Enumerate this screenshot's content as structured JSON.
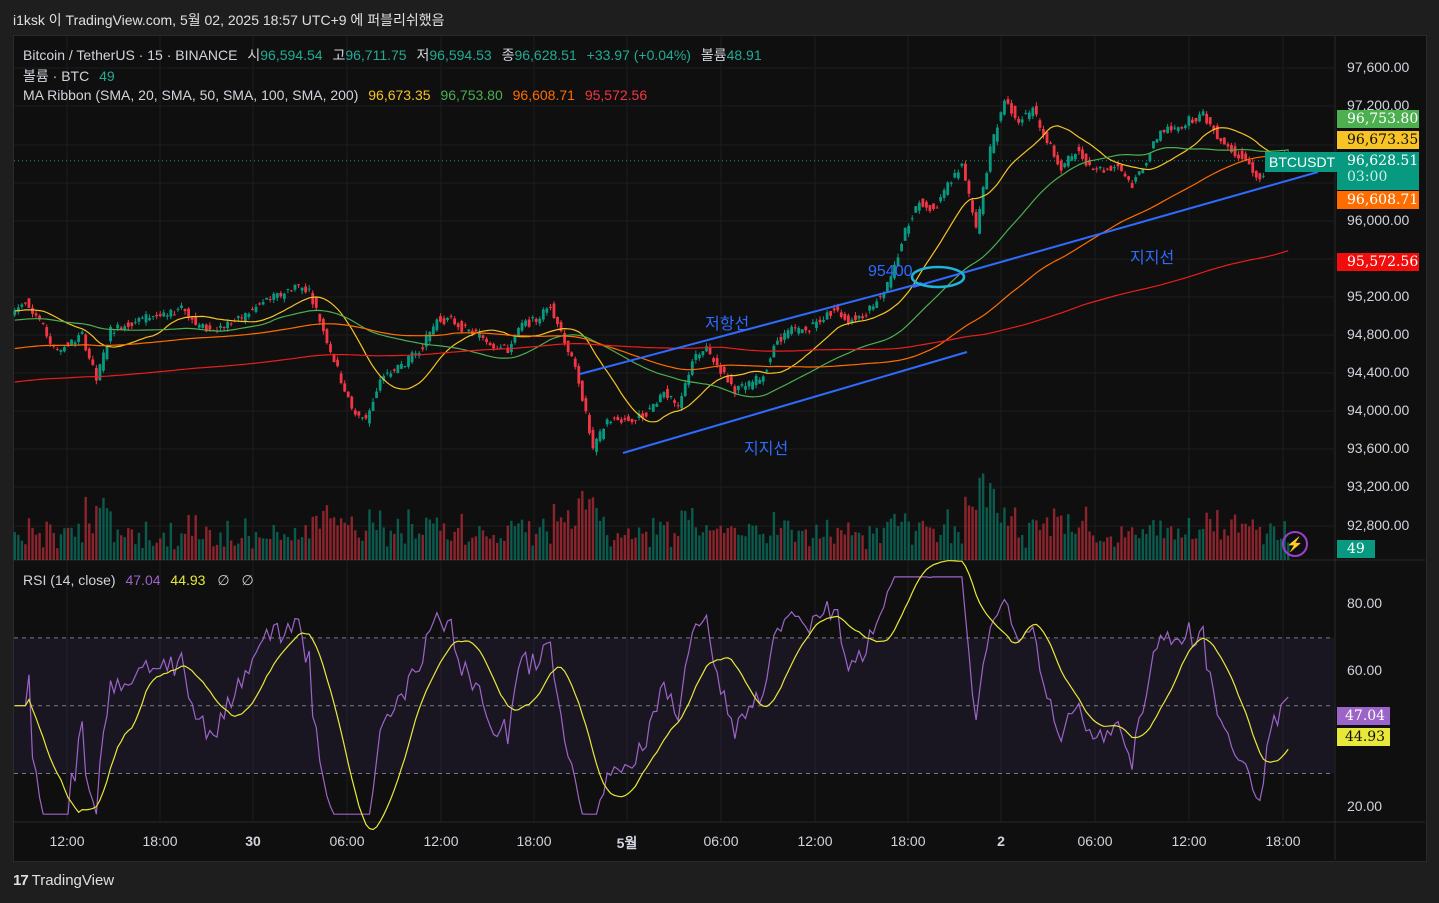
{
  "header": {
    "publish_line": "i1ksk 이 TradingView.com, 5월 02, 2025 18:57 UTC+9 에 퍼블리쉬했음"
  },
  "legend": {
    "symbol": "Bitcoin / TetherUS · 15 · BINANCE",
    "open_label": "시",
    "open": "96,594.54",
    "high_label": "고",
    "high": "96,711.75",
    "low_label": "저",
    "low": "96,594.53",
    "close_label": "종",
    "close": "96,628.51",
    "change": "+33.97 (+0.04%)",
    "vol_label": "볼륨",
    "vol": "48.91",
    "volume_title": "볼륨 · BTC",
    "volume_value": "49",
    "ma_title": "MA Ribbon (SMA, 20, SMA, 50, SMA, 100, SMA, 200)",
    "ma_values": [
      "96,673.35",
      "96,753.80",
      "96,608.71",
      "95,572.56"
    ],
    "rsi_title": "RSI (14, close)",
    "rsi_value": "47.04",
    "rsi_ma": "44.93",
    "rsi_icons": [
      "∅",
      "∅"
    ]
  },
  "price_tags": {
    "ma50": "96,753.80",
    "ma20": "96,673.35",
    "last": "96,628.51",
    "countdown": "03:00",
    "ma100": "96,608.71",
    "ma200": "95,572.56",
    "symbol": "BTCUSDT",
    "volume": "49",
    "rsi": "47.04",
    "rsi_ma": "44.93"
  },
  "annotations": {
    "level": "95400",
    "resistance": "저항선",
    "support1": "지지선",
    "support2": "지지선"
  },
  "footer": {
    "brand": "TradingView"
  },
  "colors": {
    "up": "#089981",
    "down": "#f23645",
    "ma20": "#f7c325",
    "ma50": "#4caf50",
    "ma100": "#ff6d00",
    "ma200": "#e91e1e",
    "rsi": "#9c64c8",
    "rsi_ma": "#e8e83a",
    "trend": "#2f6bff"
  },
  "chart_data": {
    "type": "candlestick",
    "title": "Bitcoin / TetherUS · 15 · BINANCE",
    "interval_note": "hourly closes (approx.)",
    "closes": [
      95011,
      95169,
      94959,
      94645,
      94697,
      94802,
      94330,
      94854,
      94907,
      94959,
      95011,
      94990,
      95116,
      94907,
      94854,
      94907,
      94959,
      95064,
      95169,
      95221,
      95326,
      95273,
      94854,
      94435,
      94016,
      93911,
      94330,
      94435,
      94540,
      94697,
      94959,
      94959,
      94854,
      94802,
      94697,
      94645,
      94907,
      94959,
      95116,
      94749,
      94330,
      93597,
      93911,
      93911,
      93911,
      94016,
      94226,
      94016,
      94540,
      94645,
      94435,
      94226,
      94278,
      94383,
      94749,
      94854,
      94854,
      94959,
      95064,
      94959,
      95011,
      95169,
      95378,
      95902,
      96217,
      96112,
      96374,
      96583,
      95902,
      96741,
      97265,
      97055,
      97160,
      96845,
      96531,
      96741,
      96583,
      96531,
      96583,
      96374,
      96636,
      96950,
      96950,
      97055,
      97107,
      96897,
      96741,
      96636,
      96426,
      96636,
      96688
    ],
    "ylim": [
      92600,
      97800
    ],
    "y_ticks": [
      "97,600.00",
      "97,200.00",
      "96,000.00",
      "95,200.00",
      "94,800.00",
      "94,400.00",
      "94,000.00",
      "93,600.00",
      "93,200.00",
      "92,800.00"
    ],
    "x_ticks": [
      "12:00",
      "18:00",
      "30",
      "06:00",
      "12:00",
      "18:00",
      "5월",
      "06:00",
      "12:00",
      "18:00",
      "2",
      "06:00",
      "12:00",
      "18:00"
    ],
    "rsi_ticks": [
      "80.00",
      "60.00",
      "20.00"
    ],
    "rsi_bands": [
      70,
      50,
      30
    ]
  }
}
